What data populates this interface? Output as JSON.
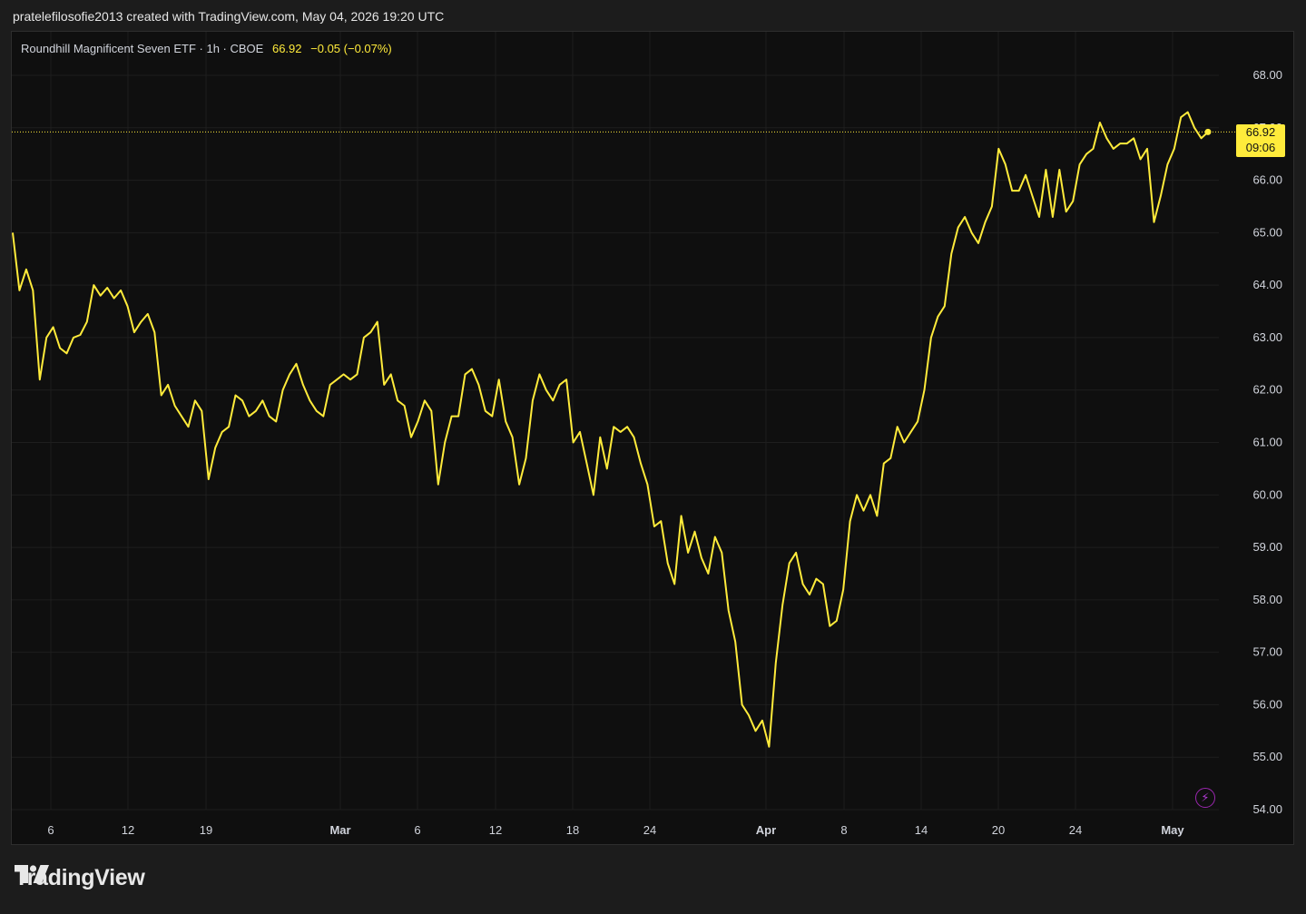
{
  "attribution": "pratelefilosofie2013 created with TradingView.com, May 04, 2026 19:20 UTC",
  "legend": {
    "symbol": "Roundhill Magnificent Seven ETF · 1h · CBOE",
    "price": "66.92",
    "change": "−0.05 (−0.07%)"
  },
  "price_label": {
    "price": "66.92",
    "countdown": "09:06"
  },
  "colors": {
    "line": "#ffeb3b",
    "background": "#0f0f0f",
    "grid": "#1e1e1e",
    "axis_text": "#d1d4dc",
    "bolt": "#9c27b0"
  },
  "icons": {
    "alert": "lightning-bolt-icon",
    "logo": "tradingview-logo-icon"
  },
  "logo": {
    "text": "TradingView"
  },
  "chart_data": {
    "type": "line",
    "title": "",
    "xlabel": "",
    "ylabel": "",
    "ylim": [
      54.0,
      68.0
    ],
    "grid": true,
    "y_ticks": [
      "68.00",
      "67.00",
      "66.00",
      "65.00",
      "64.00",
      "63.00",
      "62.00",
      "61.00",
      "60.00",
      "59.00",
      "58.00",
      "57.00",
      "56.00",
      "55.00",
      "54.00"
    ],
    "x_ticks": [
      {
        "label": "6",
        "date": "2026-02-06",
        "bold": false
      },
      {
        "label": "12",
        "date": "2026-02-12",
        "bold": false
      },
      {
        "label": "19",
        "date": "2026-02-19",
        "bold": false
      },
      {
        "label": "Mar",
        "date": "2026-03-01",
        "bold": true
      },
      {
        "label": "6",
        "date": "2026-03-06",
        "bold": false
      },
      {
        "label": "12",
        "date": "2026-03-12",
        "bold": false
      },
      {
        "label": "18",
        "date": "2026-03-18",
        "bold": false
      },
      {
        "label": "24",
        "date": "2026-03-24",
        "bold": false
      },
      {
        "label": "Apr",
        "date": "2026-04-01",
        "bold": true
      },
      {
        "label": "8",
        "date": "2026-04-08",
        "bold": false
      },
      {
        "label": "14",
        "date": "2026-04-14",
        "bold": false
      },
      {
        "label": "20",
        "date": "2026-04-20",
        "bold": false
      },
      {
        "label": "24",
        "date": "2026-04-24",
        "bold": false
      },
      {
        "label": "May",
        "date": "2026-05-01",
        "bold": true
      }
    ],
    "series": [
      {
        "values": [
          65.0,
          63.9,
          64.3,
          63.9,
          62.2,
          63.0,
          63.2,
          62.8,
          62.7,
          63.0,
          63.05,
          63.3,
          64.0,
          63.8,
          63.95,
          63.75,
          63.9,
          63.6,
          63.1,
          63.3,
          63.45,
          63.1,
          61.9,
          62.1,
          61.7,
          61.5,
          61.3,
          61.8,
          61.6,
          60.3,
          60.9,
          61.2,
          61.3,
          61.9,
          61.8,
          61.5,
          61.6,
          61.8,
          61.5,
          61.4,
          62.0,
          62.3,
          62.5,
          62.1,
          61.8,
          61.6,
          61.5,
          62.1,
          62.2,
          62.3,
          62.2,
          62.3,
          63.0,
          63.1,
          63.3,
          62.1,
          62.3,
          61.8,
          61.7,
          61.1,
          61.4,
          61.8,
          61.6,
          60.2,
          61.0,
          61.5,
          61.5,
          62.3,
          62.4,
          62.1,
          61.6,
          61.5,
          62.2,
          61.4,
          61.1,
          60.2,
          60.7,
          61.8,
          62.3,
          62.0,
          61.8,
          62.1,
          62.2,
          61.0,
          61.2,
          60.6,
          60.0,
          61.1,
          60.5,
          61.3,
          61.2,
          61.3,
          61.1,
          60.6,
          60.2,
          59.4,
          59.5,
          58.7,
          58.3,
          59.6,
          58.9,
          59.3,
          58.8,
          58.5,
          59.2,
          58.9,
          57.8,
          57.2,
          56.0,
          55.8,
          55.5,
          55.7,
          55.2,
          56.8,
          57.9,
          58.7,
          58.9,
          58.3,
          58.1,
          58.4,
          58.3,
          57.5,
          57.6,
          58.2,
          59.5,
          60.0,
          59.7,
          60.0,
          59.6,
          60.6,
          60.7,
          61.3,
          61.0,
          61.2,
          61.4,
          62.0,
          63.0,
          63.4,
          63.6,
          64.6,
          65.1,
          65.3,
          65.0,
          64.8,
          65.2,
          65.5,
          66.6,
          66.3,
          65.8,
          65.8,
          66.1,
          65.7,
          65.3,
          66.2,
          65.3,
          66.2,
          65.4,
          65.6,
          66.3,
          66.5,
          66.6,
          67.1,
          66.8,
          66.6,
          66.7,
          66.7,
          66.8,
          66.4,
          66.6,
          65.2,
          65.7,
          66.3,
          66.6,
          67.2,
          67.3,
          67.0,
          66.8,
          66.92
        ]
      }
    ]
  }
}
